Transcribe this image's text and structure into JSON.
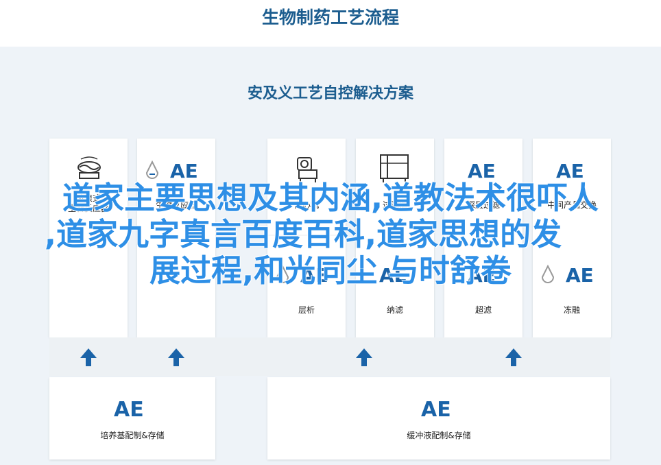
{
  "header": {
    "title": "生物制药工艺流程"
  },
  "panel": {
    "title": "安及义工艺自控解决方案"
  },
  "upper_row": [
    {
      "label": "波浪式\n生物反应器",
      "icon": "wave-bioreactor-icon"
    },
    {
      "label": "生物反应器",
      "icon": "ae-logo"
    },
    {
      "label": "离心机",
      "icon": "centrifuge-icon"
    },
    {
      "label": "过滤器",
      "icon": "filter-icon"
    },
    {
      "label": "深层过滤",
      "icon": "ae-logo"
    },
    {
      "label": "中间产品交换",
      "icon": "ae-logo"
    }
  ],
  "lower_row": [
    {
      "label": "层析",
      "icon": "ae-logo"
    },
    {
      "label": "纳滤",
      "icon": "ae-logo"
    },
    {
      "label": "超滤",
      "icon": "ae-logo"
    },
    {
      "label": "冻融",
      "icon": "ae-logo"
    }
  ],
  "bottom_blocks": [
    {
      "label": "培养基配制&存储"
    },
    {
      "label": "缓冲液配制&存储"
    }
  ],
  "overlay": {
    "line1": "道家主要思想及其内涵,道教法术很吓人",
    "line2": ",道家九字真言百度百科,道家思想的发",
    "line3": "展过程,和光同尘 与时舒卷"
  },
  "colors": {
    "brand": "#1c5d8f",
    "ae_blue": "#1a63a8",
    "overlay": "#2e8fe6",
    "panel_bg": "#eef3f8"
  }
}
